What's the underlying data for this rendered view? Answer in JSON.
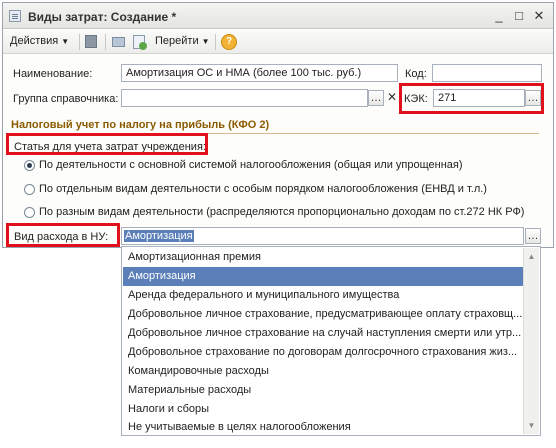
{
  "window": {
    "title": "Виды затрат: Создание *"
  },
  "controls": {
    "minimize": "_",
    "maximize": "□",
    "close": "✕"
  },
  "toolbar": {
    "actions": "Действия",
    "goto": "Перейти",
    "help": "?"
  },
  "form": {
    "name_label": "Наименование:",
    "name_value": "Амортизация ОС и НМА (более 100 тыс. руб.)",
    "code_label": "Код:",
    "code_value": "",
    "group_label": "Группа справочника:",
    "group_value": "",
    "kek_label": "КЭК:",
    "kek_value": "271",
    "section_title": "Налоговый учет по налогу на прибыль (КФО 2)",
    "article_label": "Статья для учета затрат учреждения:",
    "radio1": "По деятельности с основной системой налогообложения (общая или упрощенная)",
    "radio2": "По отдельным видам деятельности с особым порядком налогообложения (ЕНВД и т.л.)",
    "radio3": "По разным видам деятельности (распределяются пропорционально доходам по ст.272 НК РФ)",
    "expense_label": "Вид расхода в НУ:",
    "expense_value": "Амортизация"
  },
  "dropdown": {
    "items": [
      "Амортизационная премия",
      "Амортизация",
      "Аренда федерального и муниципального имущества",
      "Добровольное личное страхование, предусматривающее оплату страховщ...",
      "Добровольное личное страхование на случай наступления смерти или утр...",
      "Добровольное страхование по договорам долгосрочного страхования жиз...",
      "Командировочные расходы",
      "Материальные расходы",
      "Налоги и сборы",
      "Не учитываемые в целях налогообложения"
    ],
    "selected_index": 1
  },
  "colors": {
    "highlight": "#e0101c",
    "selection": "#5b7fb8",
    "section": "#8b5a00"
  }
}
